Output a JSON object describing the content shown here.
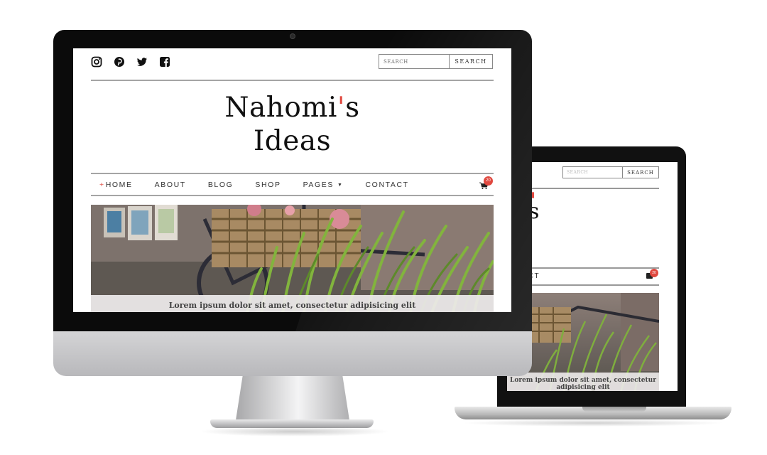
{
  "site": {
    "title_line1": "Nahomi",
    "title_apostrophe": "'",
    "title_possessive": "s",
    "title_line2": "Ideas"
  },
  "search": {
    "placeholder": "SEARCH",
    "button_label": "SEARCH"
  },
  "social": {
    "icons": [
      "instagram-icon",
      "pinterest-icon",
      "twitter-icon",
      "facebook-icon"
    ]
  },
  "nav": {
    "items": [
      {
        "prefix": "+",
        "label": "HOME"
      },
      {
        "label": "ABOUT"
      },
      {
        "label": "BLOG"
      },
      {
        "label": "SHOP"
      },
      {
        "label": "PAGES",
        "dropdown": true
      },
      {
        "label": "CONTACT"
      }
    ],
    "cart_count": "20"
  },
  "hero": {
    "caption": "Lorem ipsum dolor sit amet, consectetur adipisicing elit"
  },
  "laptop": {
    "title_fragment": "s",
    "nav_fragment": "NTACT",
    "cart_count": "20",
    "caption": "Lorem ipsum dolor sit amet, consectetur adipisicing elit",
    "search_placeholder": "SEARCH",
    "search_button": "SEARCH"
  },
  "colors": {
    "accent": "#e0483f",
    "text": "#333333",
    "rule": "#a5a5a5"
  }
}
